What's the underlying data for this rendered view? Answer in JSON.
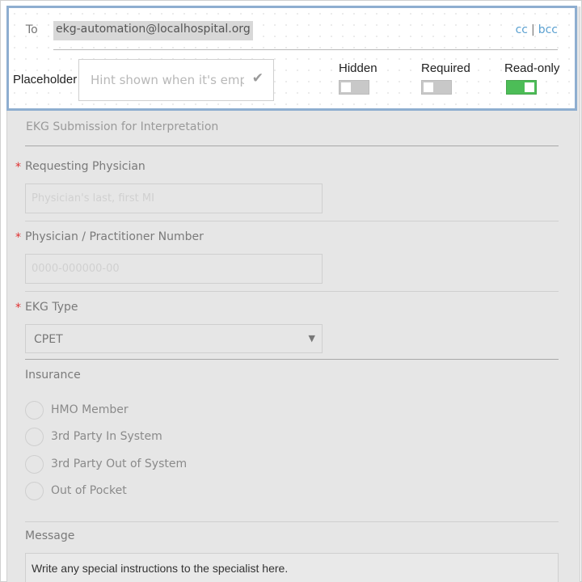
{
  "settings_popover": {
    "to_label": "To",
    "to_value": "ekg-automation@localhospital.org",
    "cc_label": "cc",
    "separator": "|",
    "bcc_label": "bcc",
    "placeholder_label": "Placeholder",
    "placeholder_hint": "Hint shown when it's empty",
    "toggles": [
      {
        "label": "Hidden",
        "on": false
      },
      {
        "label": "Required",
        "on": false
      },
      {
        "label": "Read-only",
        "on": true
      }
    ]
  },
  "form": {
    "title": "EKG Submission for Interpretation",
    "required_marker": "*",
    "fields": {
      "requesting_physician": {
        "label": "Requesting Physician",
        "placeholder": "Physician's last, first MI",
        "required": true
      },
      "practitioner_number": {
        "label": "Physician / Practitioner Number",
        "placeholder": "0000-000000-00",
        "required": true
      },
      "ekg_type": {
        "label": "EKG Type",
        "selected": "CPET",
        "caret": "▼",
        "required": true
      },
      "insurance": {
        "label": "Insurance",
        "options": [
          "HMO Member",
          "3rd Party In System",
          "3rd Party Out of System",
          "Out of Pocket"
        ]
      },
      "message": {
        "label": "Message",
        "value": "Write any special instructions to the specialist here."
      }
    }
  },
  "colors": {
    "accent_border": "#8eaed0",
    "toggle_on": "#4cbd57",
    "required_star": "#e03030",
    "link": "#5aa0d0"
  },
  "icons": {
    "placeholder_confirm": "checkmark-icon",
    "select_caret": "chevron-down-icon"
  }
}
